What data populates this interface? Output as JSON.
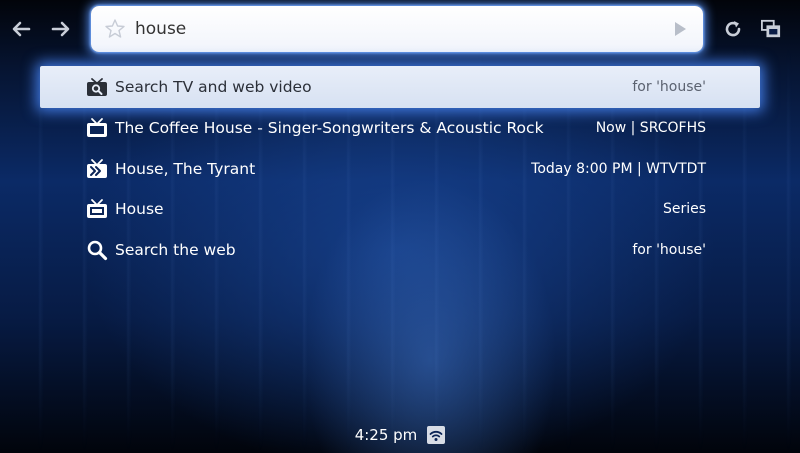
{
  "toolbar": {
    "back_icon": "arrow-left-icon",
    "forward_icon": "arrow-right-icon",
    "refresh_icon": "refresh-icon",
    "windows_icon": "windows-icon"
  },
  "omnibox": {
    "value": "house",
    "star_icon": "star-icon",
    "go_icon": "play-icon"
  },
  "suggestions": [
    {
      "icon": "tv-search-icon",
      "label": "Search TV and web video",
      "detail": "for 'house'",
      "selected": true
    },
    {
      "icon": "tv-icon",
      "label": "The Coffee House - Singer-Songwriters & Acoustic Rock",
      "detail": "Now | SRCOFHS"
    },
    {
      "icon": "tv-forward-icon",
      "label": "House, The Tyrant",
      "detail": "Today 8:00 PM | WTVTDT"
    },
    {
      "icon": "tv-series-icon",
      "label": "House",
      "detail": "Series"
    },
    {
      "icon": "search-icon",
      "label": "Search the web",
      "detail": "for 'house'"
    }
  ],
  "status": {
    "time": "4:25 pm",
    "wifi_icon": "wifi-icon"
  },
  "colors": {
    "accent_glow": "#4682f0",
    "background": "#0b2a66"
  }
}
